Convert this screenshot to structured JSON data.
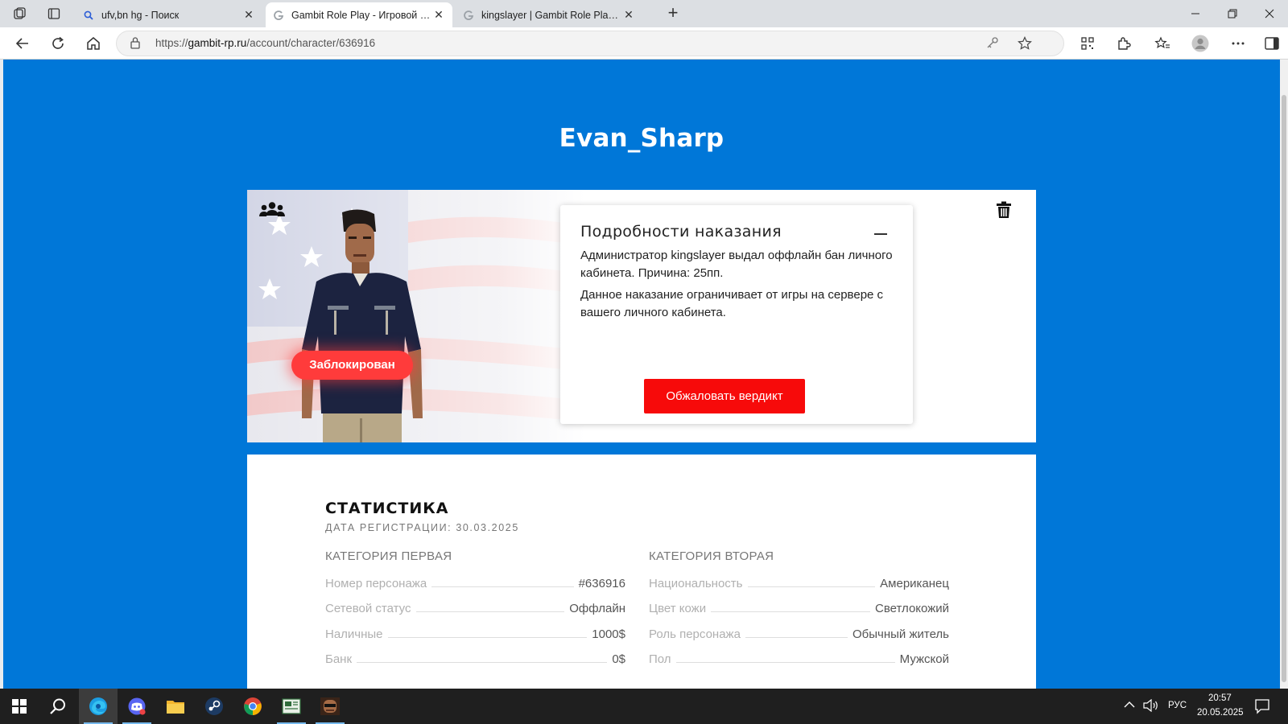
{
  "browser": {
    "tabs": [
      {
        "title": "ufv,bn hg - Поиск",
        "favicon": "search-icon",
        "active": false
      },
      {
        "title": "Gambit Role Play - Игровой проект",
        "favicon": "gambit-logo-icon",
        "active": true
      },
      {
        "title": "kingslayer | Gambit Role Play - Форум",
        "favicon": "gambit-logo-icon",
        "active": false
      }
    ],
    "url_prefix": "https://",
    "url_host": "gambit-rp.ru",
    "url_path": "/account/character/636916"
  },
  "character": {
    "name": "Evan_Sharp",
    "status_badge": "Заблокирован"
  },
  "penalty": {
    "title": "Подробности наказания",
    "text1": "Администратор kingslayer выдал оффлайн бан личного кабинета. Причина: 25пп.",
    "text2": "Данное наказание ограничивает от игры на сервере с вашего личного кабинета.",
    "appeal_label": "Обжаловать вердикт"
  },
  "stats": {
    "title": "СТАТИСТИКА",
    "reg_date": "ДАТА РЕГИСТРАЦИИ: 30.03.2025",
    "cat1": {
      "title": "КАТЕГОРИЯ ПЕРВАЯ",
      "rows": [
        {
          "label": "Номер персонажа",
          "value": "#636916"
        },
        {
          "label": "Сетевой статус",
          "value": "Оффлайн"
        },
        {
          "label": "Наличные",
          "value": "1000$"
        },
        {
          "label": "Банк",
          "value": "0$"
        }
      ]
    },
    "cat2": {
      "title": "КАТЕГОРИЯ ВТОРАЯ",
      "rows": [
        {
          "label": "Национальность",
          "value": "Американец"
        },
        {
          "label": "Цвет кожи",
          "value": "Светлокожий"
        },
        {
          "label": "Роль персонажа",
          "value": "Обычный житель"
        },
        {
          "label": "Пол",
          "value": "Мужской"
        }
      ]
    }
  },
  "taskbar": {
    "language": "РУС",
    "time": "20:57",
    "date": "20.05.2025"
  },
  "colors": {
    "page_bg": "#0077d8",
    "accent_red": "#f70a0a",
    "badge_red": "#ff3b3b"
  }
}
